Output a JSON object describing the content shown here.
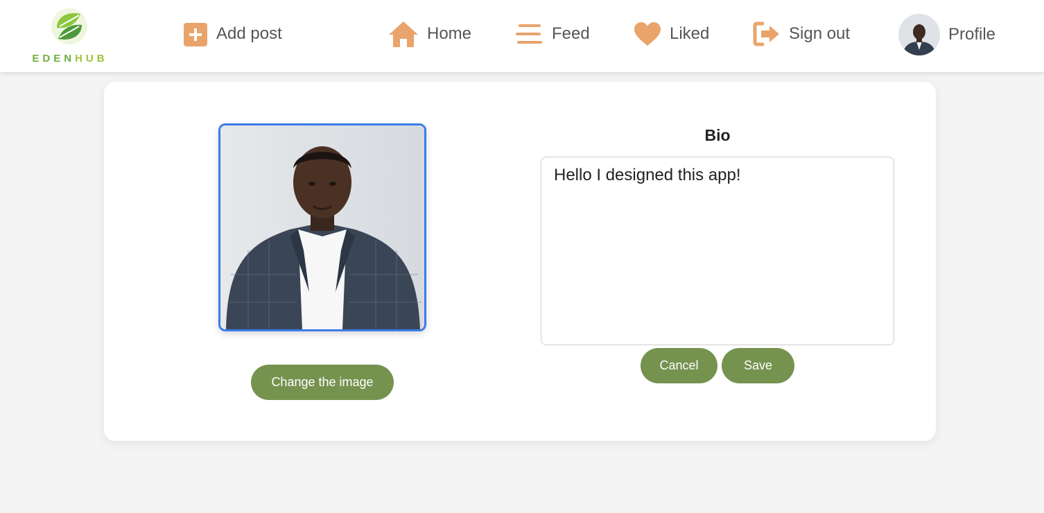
{
  "brand": {
    "name_part1": "EDEN",
    "name_part2": "HUB",
    "colors": {
      "primary_green": "#6fae3f",
      "light_green": "#9cc43a"
    }
  },
  "nav": {
    "add_post": {
      "label": "Add post",
      "icon": "plus-square-icon"
    },
    "home": {
      "label": "Home",
      "icon": "house-icon"
    },
    "feed": {
      "label": "Feed",
      "icon": "menu-lines-icon"
    },
    "liked": {
      "label": "Liked",
      "icon": "heart-icon"
    },
    "sign_out": {
      "label": "Sign out",
      "icon": "sign-out-icon"
    },
    "profile": {
      "label": "Profile",
      "icon": "avatar"
    },
    "icon_color": "#e9a46b"
  },
  "profile_card": {
    "change_image_label": "Change the image",
    "bio_title": "Bio",
    "bio_value": "Hello I designed this app!",
    "cancel_label": "Cancel",
    "save_label": "Save",
    "button_color": "#76924f",
    "photo_border_color": "#3b7be8"
  }
}
